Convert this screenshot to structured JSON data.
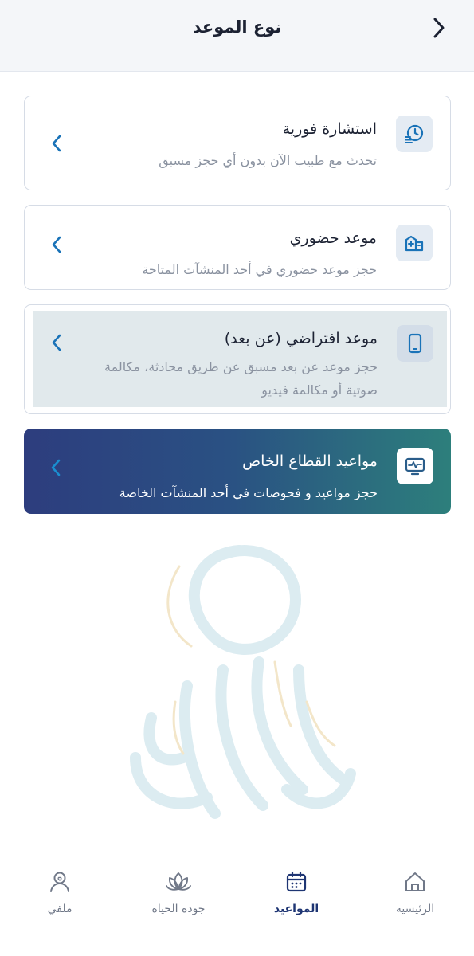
{
  "header": {
    "title": "نوع الموعد",
    "back_icon": "chevron-right-icon"
  },
  "options": [
    {
      "title": "استشارة فورية",
      "description": "تحدث مع طبيب الآن بدون أي حجز مسبق",
      "icon": "clock-list-icon"
    },
    {
      "title": "موعد حضوري",
      "description": "حجز موعد حضوري في أحد المنشآت المتاحة",
      "icon": "clinic-building-icon"
    },
    {
      "title": "موعد افتراضي (عن بعد)",
      "description": "حجز موعد عن بعد مسبق عن طريق محادثة، مكالمة صوتية أو مكالمة فيديو",
      "icon": "mobile-phone-icon",
      "selected": true
    },
    {
      "title": "مواعيد القطاع الخاص",
      "description": "حجز مواعيد و فحوصات في أحد المنشآت الخاصة",
      "icon": "monitor-pulse-icon"
    }
  ],
  "bottom_nav": [
    {
      "label": "الرئيسية",
      "icon": "home-icon",
      "active": false
    },
    {
      "label": "المواعيد",
      "icon": "calendar-icon",
      "active": true
    },
    {
      "label": "جودة الحياة",
      "icon": "lotus-icon",
      "active": false
    },
    {
      "label": "ملفي",
      "icon": "profile-icon",
      "active": false
    }
  ],
  "colors": {
    "primary": "#1e3573",
    "accent_blue": "#1a73b8",
    "muted_text": "#8a92a0",
    "selected_bg": "#e1e9ec",
    "gradient_start": "#2d3d7e",
    "gradient_end": "#2d7f7c"
  }
}
